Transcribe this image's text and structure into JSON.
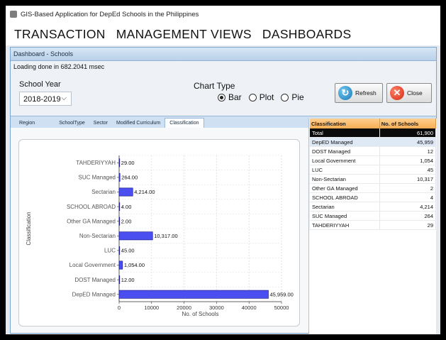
{
  "window": {
    "title": "GIS-Based Application for DepEd Schools in the Philippines"
  },
  "menu": {
    "items": [
      "TRANSACTION",
      "MANAGEMENT VIEWS",
      "DASHBOARDS"
    ]
  },
  "dashboard": {
    "header": "Dashboard - Schools",
    "loading_text": "Loading done in 682.2041 msec",
    "school_year": {
      "label": "School Year",
      "value": "2018-2019"
    },
    "chart_type": {
      "label": "Chart Type",
      "options": [
        "Bar",
        "Plot",
        "Pie"
      ],
      "selected": "Bar"
    },
    "buttons": {
      "refresh": "Refresh",
      "close": "Close"
    },
    "tabs": [
      "Region",
      "SchoolType",
      "Sector",
      "Modified Curriculum",
      "Classification"
    ],
    "active_tab": "Classification"
  },
  "table": {
    "headers": [
      "Classification",
      "No. of Schools"
    ],
    "rows": [
      [
        "Total",
        "61,900"
      ],
      [
        "DepED Managed",
        "45,959"
      ],
      [
        "DOST Managed",
        "12"
      ],
      [
        "Local Government",
        "1,054"
      ],
      [
        "LUC",
        "45"
      ],
      [
        "Non-Sectarian",
        "10,317"
      ],
      [
        "Other GA Managed",
        "2"
      ],
      [
        "SCHOOL ABROAD",
        "4"
      ],
      [
        "Sectarian",
        "4,214"
      ],
      [
        "SUC Managed",
        "264"
      ],
      [
        "TAHDERIYYAH",
        "29"
      ]
    ]
  },
  "colors": {
    "bar": "#4b4ff0",
    "bar_stroke": "#0d0d7a",
    "table_header": "#f7ad55",
    "accent": "#1c79b7"
  },
  "chart_data": {
    "type": "bar",
    "orientation": "horizontal",
    "categories": [
      "TAHDERIYYAH",
      "SUC Managed",
      "Sectarian",
      "SCHOOL ABROAD",
      "Other GA Managed",
      "Non-Sectarian",
      "LUC",
      "Local Government",
      "DOST Managed",
      "DepED Managed"
    ],
    "values": [
      29,
      264,
      4214,
      4,
      2,
      10317,
      45,
      1054,
      12,
      45959
    ],
    "data_labels": [
      "29.00",
      "264.00",
      "4,214.00",
      "4.00",
      "2.00",
      "10,317.00",
      "45.00",
      "1,054.00",
      "12.00",
      "45,959.00"
    ],
    "xlabel": "No. of Schools",
    "ylabel": "Classification",
    "xlim": [
      0,
      50000
    ],
    "xticks": [
      0,
      10000,
      20000,
      30000,
      40000,
      50000
    ],
    "xtick_labels": [
      "0",
      "10000",
      "20000",
      "30000",
      "40000",
      "50000"
    ],
    "grid": true
  }
}
